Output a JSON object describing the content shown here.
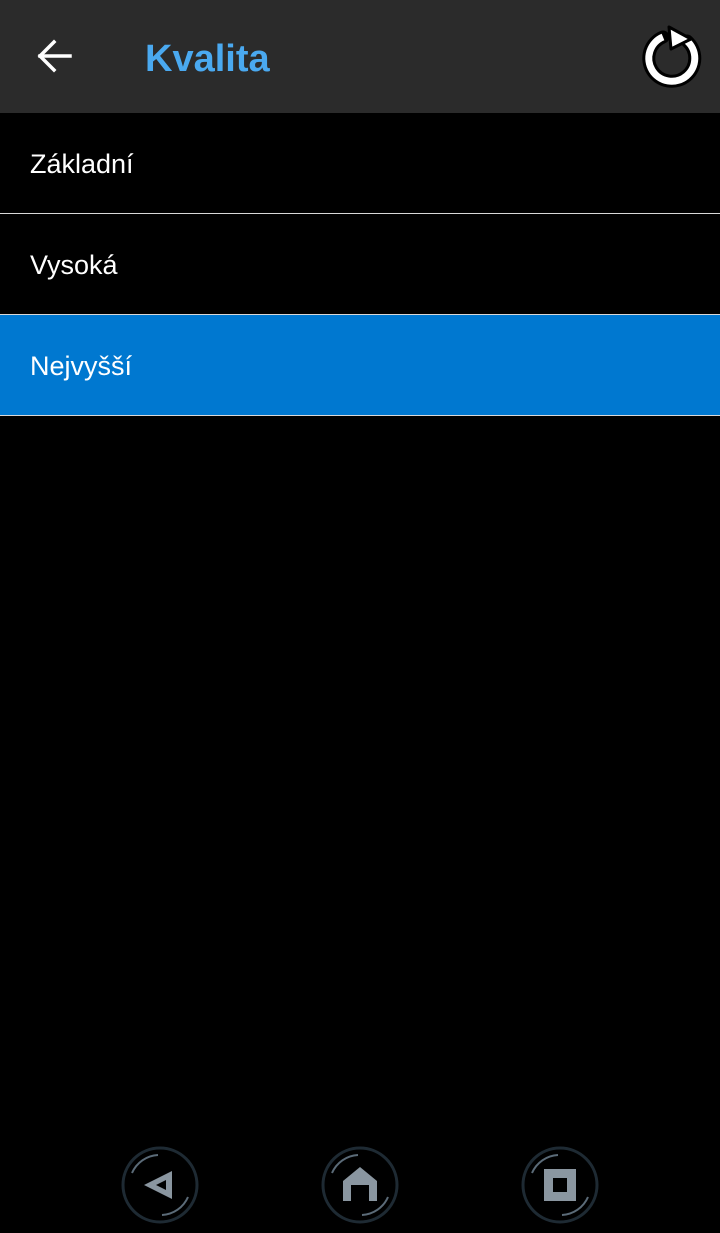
{
  "header": {
    "title": "Kvalita",
    "back_icon": "arrow-left-icon",
    "reset_icon": "rotate-cw-icon",
    "title_color": "#4aa9f0",
    "background": "#2b2b2b"
  },
  "quality_options": [
    {
      "label": "Základní",
      "selected": false
    },
    {
      "label": "Vysoká",
      "selected": false
    },
    {
      "label": "Nejvyšší",
      "selected": true
    }
  ],
  "selection_color": "#0078d0",
  "system_nav": {
    "back_icon": "triangle-back-icon",
    "home_icon": "house-icon",
    "recent_icon": "square-recents-icon"
  }
}
